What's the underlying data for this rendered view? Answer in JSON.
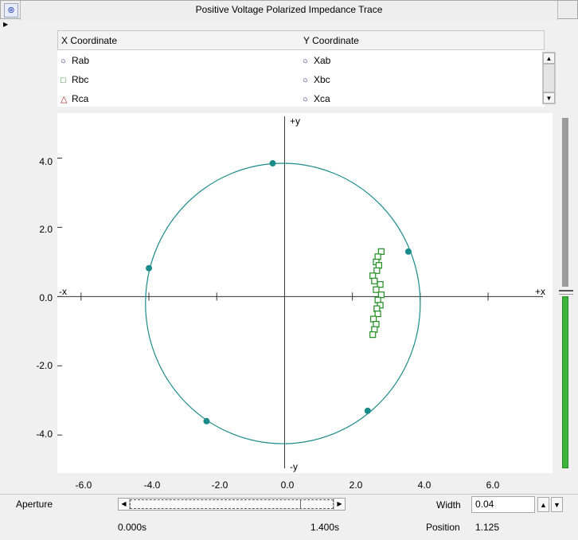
{
  "window": {
    "title": "Positive Voltage Polarized Impedance Trace"
  },
  "legend": {
    "x_header": "X Coordinate",
    "y_header": "Y Coordinate",
    "rows": [
      {
        "x_icon": "○",
        "x_label": "Rab",
        "y_icon": "○",
        "y_label": "Xab"
      },
      {
        "x_icon": "□",
        "x_label": "Rbc",
        "y_icon": "○",
        "y_label": "Xbc"
      },
      {
        "x_icon": "△",
        "x_label": "Rca",
        "y_icon": "○",
        "y_label": "Xca"
      }
    ]
  },
  "colors": {
    "circle": "#1a8a8a",
    "trace": "#1e8c1e",
    "rca": "#a02020",
    "icon_blue": "#1c2a9c"
  },
  "chart_data": {
    "type": "scatter",
    "xlim": [
      -6.7,
      7.9
    ],
    "ylim": [
      -5.1,
      5.3
    ],
    "x_ticks": [
      -6.0,
      -4.0,
      -2.0,
      0.0,
      2.0,
      4.0,
      6.0
    ],
    "x_tick_labels": [
      "-6.0",
      "-4.0",
      "-2.0",
      "0.0",
      "2.0",
      "4.0",
      "6.0"
    ],
    "y_ticks": [
      4.0,
      2.0,
      0.0,
      -2.0,
      -4.0
    ],
    "y_tick_labels": [
      "4.0",
      "2.0",
      "0.0",
      "-2.0",
      "-4.0"
    ],
    "axis_labels": {
      "neg_x": "-x",
      "pos_x": "+x",
      "pos_y": "+y",
      "neg_y": "-y"
    },
    "circle": {
      "center": [
        -0.05,
        -0.2
      ],
      "radius": 4.05
    },
    "circle_points": [
      [
        -0.35,
        3.85
      ],
      [
        3.65,
        1.3
      ],
      [
        -4.0,
        0.82
      ],
      [
        2.45,
        -3.3
      ],
      [
        -2.3,
        -3.6
      ]
    ],
    "series": [
      {
        "marker": "square",
        "points": [
          [
            2.85,
            1.3
          ],
          [
            2.75,
            1.15
          ],
          [
            2.7,
            1.0
          ],
          [
            2.78,
            0.9
          ],
          [
            2.72,
            0.75
          ],
          [
            2.6,
            0.6
          ],
          [
            2.65,
            0.45
          ],
          [
            2.82,
            0.35
          ],
          [
            2.7,
            0.2
          ],
          [
            2.85,
            0.05
          ],
          [
            2.75,
            -0.1
          ],
          [
            2.82,
            -0.25
          ],
          [
            2.72,
            -0.35
          ],
          [
            2.75,
            -0.5
          ],
          [
            2.62,
            -0.65
          ],
          [
            2.7,
            -0.8
          ],
          [
            2.65,
            -0.95
          ],
          [
            2.6,
            -1.1
          ]
        ]
      }
    ]
  },
  "bottom": {
    "aperture_label": "Aperture",
    "width_label": "Width",
    "width_value": "0.04",
    "position_label": "Position",
    "position_value": "1.125",
    "time_start": "0.000s",
    "time_end": "1.400s"
  }
}
